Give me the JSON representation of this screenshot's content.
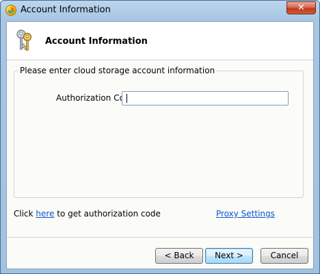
{
  "window": {
    "title": "Account Information",
    "close_glyph": "✕"
  },
  "header": {
    "title": "Account Information",
    "icon": "keys-icon"
  },
  "group": {
    "legend": "Please enter cloud storage account information",
    "auth_label": "Authorization Code",
    "auth_value": ""
  },
  "help": {
    "prefix": "Click ",
    "link": "here",
    "suffix": " to get authorization code",
    "proxy_link": "Proxy Settings"
  },
  "buttons": {
    "back": "< Back",
    "next": "Next >",
    "cancel": "Cancel"
  },
  "colors": {
    "link": "#0b57d0",
    "default_button_border": "#3c7fb1",
    "close_button": "#c2391d"
  }
}
